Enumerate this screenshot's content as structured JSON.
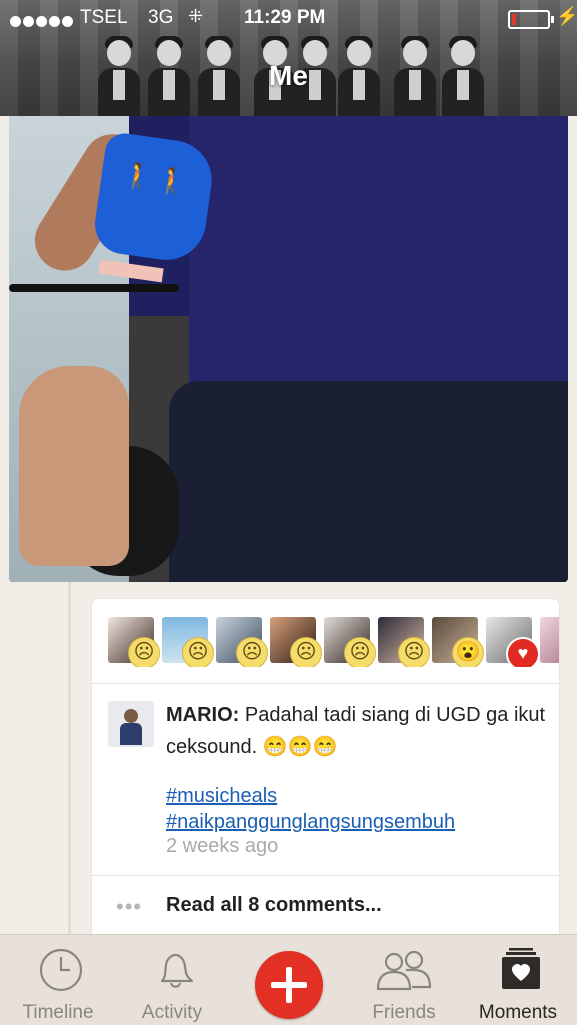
{
  "status_bar": {
    "carrier": "TSEL",
    "network": "3G",
    "time": "11:29 PM",
    "signal_dots": 5,
    "battery_level": 0.1
  },
  "header": {
    "title": "Me"
  },
  "reactions": [
    {
      "emoji": "☹",
      "icon": "sad-face-icon"
    },
    {
      "emoji": "☹",
      "icon": "sad-face-icon"
    },
    {
      "emoji": "☹",
      "icon": "sad-face-icon"
    },
    {
      "emoji": "☹",
      "icon": "sad-face-icon"
    },
    {
      "emoji": "☹",
      "icon": "sad-face-icon"
    },
    {
      "emoji": "☹",
      "icon": "sad-face-icon"
    },
    {
      "emoji": "😮",
      "icon": "surprised-face-icon"
    },
    {
      "emoji": "♥",
      "icon": "heart-icon"
    }
  ],
  "comment": {
    "author": "MARIO:",
    "text": "Padahal tadi siang di UGD ga ikut ceksound. 😁😁😁",
    "hashtags": [
      "#musicheals",
      "#naikpanggunglangsungsembuh"
    ],
    "time_ago": "2 weeks ago"
  },
  "read_more": {
    "dots": "•••",
    "label": "Read all 8 comments..."
  },
  "tabs": [
    {
      "label": "Timeline",
      "icon": "clock-icon"
    },
    {
      "label": "Activity",
      "icon": "bell-icon"
    },
    {
      "label": "",
      "icon": "plus-icon"
    },
    {
      "label": "Friends",
      "icon": "friends-icon"
    },
    {
      "label": "Moments",
      "icon": "moments-icon",
      "active": true
    }
  ],
  "colors": {
    "accent_red": "#e33024",
    "link_blue": "#1a5fb4",
    "background": "#f1ede7"
  }
}
